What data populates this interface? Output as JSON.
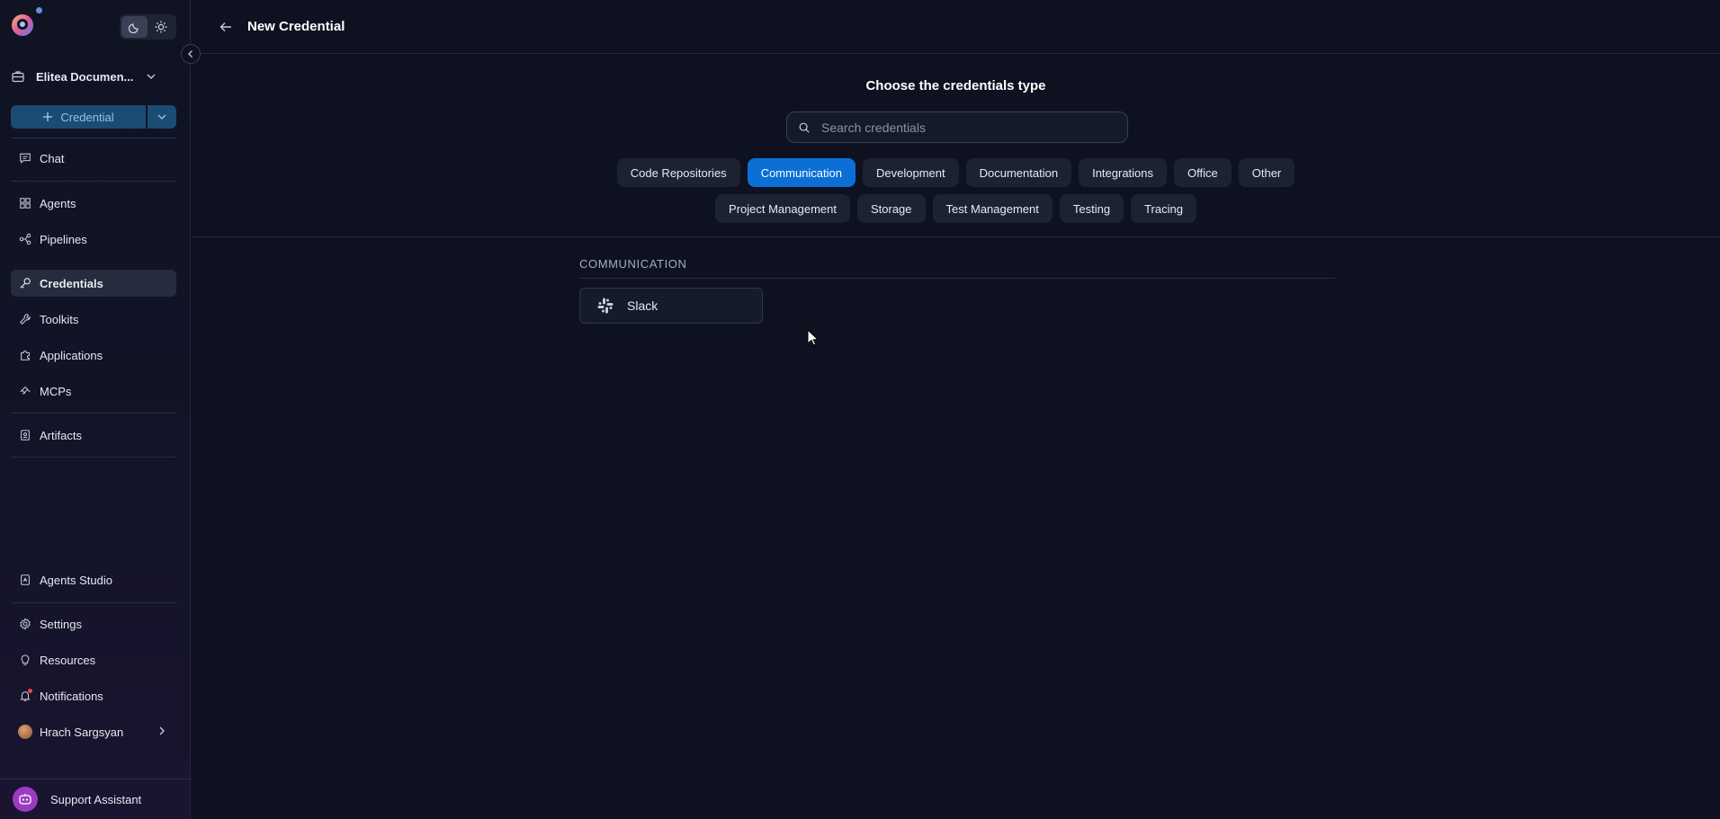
{
  "sidebar": {
    "project": {
      "label": "Elitea Documen..."
    },
    "create": {
      "label": "Credential"
    },
    "nav_main": [
      {
        "label": "Chat",
        "icon": "chat-icon"
      },
      {
        "label": "Agents",
        "icon": "grid-icon"
      },
      {
        "label": "Pipelines",
        "icon": "pipeline-icon"
      },
      {
        "label": "Credentials",
        "icon": "key-icon",
        "active": true
      },
      {
        "label": "Toolkits",
        "icon": "wrench-icon"
      },
      {
        "label": "Applications",
        "icon": "puzzle-icon"
      },
      {
        "label": "MCPs",
        "icon": "mcp-icon"
      },
      {
        "label": "Artifacts",
        "icon": "artifact-icon"
      }
    ],
    "nav_bottom": [
      {
        "label": "Agents Studio",
        "icon": "studio-icon"
      },
      {
        "label": "Settings",
        "icon": "gear-icon"
      },
      {
        "label": "Resources",
        "icon": "lightbulb-icon"
      },
      {
        "label": "Notifications",
        "icon": "bell-icon"
      },
      {
        "label": "Hrach Sargsyan",
        "icon": "avatar"
      }
    ],
    "support": {
      "label": "Support Assistant"
    }
  },
  "header": {
    "title": "New Credential"
  },
  "picker": {
    "title": "Choose the credentials type",
    "search_placeholder": "Search credentials",
    "categories_row1": [
      "Code Repositories",
      "Communication",
      "Development",
      "Documentation",
      "Integrations",
      "Office",
      "Other"
    ],
    "categories_row2": [
      "Project Management",
      "Storage",
      "Test Management",
      "Testing",
      "Tracing"
    ],
    "selected_category": "Communication"
  },
  "results": {
    "section_title": "COMMUNICATION",
    "items": [
      {
        "label": "Slack",
        "icon": "slack-icon"
      }
    ]
  },
  "colors": {
    "accent": "#0b6fd6",
    "create_button": "#1c4b73",
    "background": "#0e1220"
  }
}
